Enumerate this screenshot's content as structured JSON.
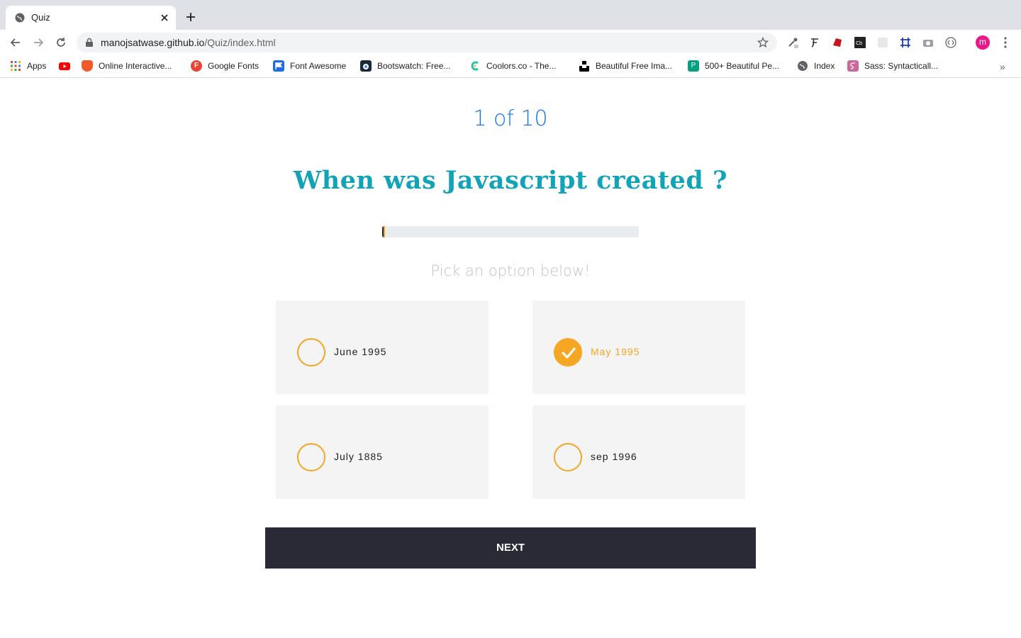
{
  "browser": {
    "tab_title": "Quiz",
    "url_host": "manojsatwase.github.io",
    "url_path": "/Quiz/index.html",
    "profile_initial": "m",
    "bookmarks": [
      {
        "label": "Apps",
        "icon": "apps-grid-icon"
      },
      {
        "label": "",
        "icon": "youtube-icon"
      },
      {
        "label": "Online Interactive...",
        "icon": "codepen-icon"
      },
      {
        "label": "Google Fonts",
        "icon": "google-fonts-icon"
      },
      {
        "label": "Font Awesome",
        "icon": "font-awesome-flag-icon"
      },
      {
        "label": "Bootswatch: Free...",
        "icon": "bootswatch-icon"
      },
      {
        "label": "Coolors.co - The...",
        "icon": "coolors-icon"
      },
      {
        "label": "Beautiful Free Ima...",
        "icon": "unsplash-icon"
      },
      {
        "label": "500+ Beautiful Pe...",
        "icon": "pexels-icon"
      },
      {
        "label": "Index",
        "icon": "globe-icon"
      },
      {
        "label": "Sass: Syntacticall...",
        "icon": "sass-icon"
      }
    ]
  },
  "quiz": {
    "counter": "1 of 10",
    "question": "When was Javascript created ?",
    "progress_fraction": 0.1,
    "instruction": "Pick an option below!",
    "options": [
      {
        "label": "June 1995",
        "selected": false
      },
      {
        "label": "May 1995",
        "selected": true
      },
      {
        "label": "July 1885",
        "selected": false
      },
      {
        "label": "sep 1996",
        "selected": false
      }
    ],
    "next_label": "NEXT"
  },
  "colors": {
    "accent": "#f5a623",
    "question": "#12a3b8",
    "counter": "#1a73e8",
    "button": "#2a2a36"
  }
}
